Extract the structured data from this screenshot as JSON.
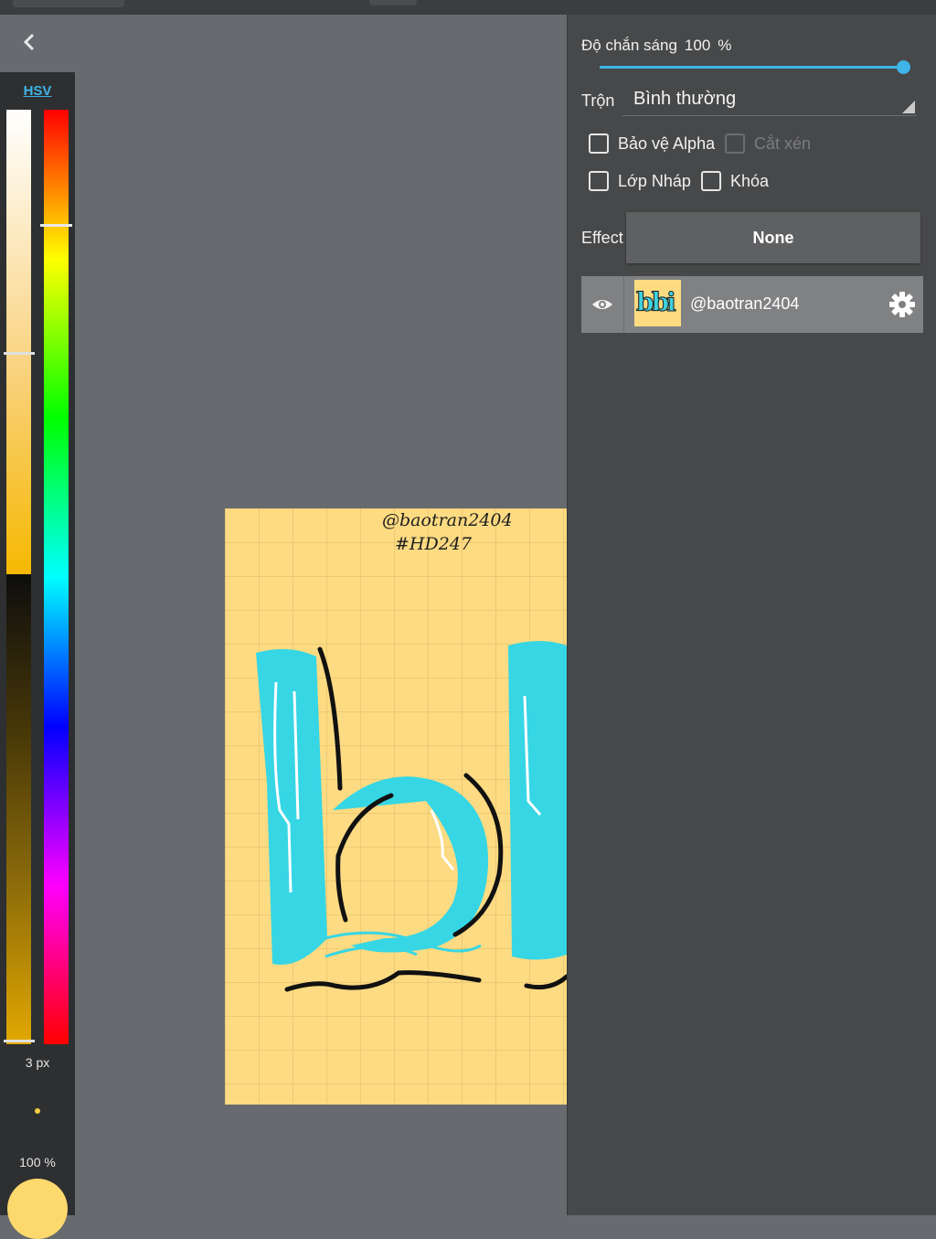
{
  "toolbar": {
    "back_icon": "chevron-left-icon"
  },
  "color_panel": {
    "mode_label": "HSV",
    "brush_size": "3 px",
    "brush_opacity": "100 %",
    "current_color": "#fdd86d",
    "saturation_value_level": 0.26,
    "hue_level": 0.12
  },
  "layer_props": {
    "opacity_label": "Độ chắn sáng",
    "opacity_value": "100",
    "opacity_unit": "%",
    "opacity_level": 1.0,
    "blend_label": "Trộn",
    "blend_value": "Bình thường",
    "checkboxes": {
      "protect_alpha": "Bảo vệ Alpha",
      "clipping": "Cắt xén",
      "draft_layer": "Lớp Nháp",
      "lock": "Khóa"
    },
    "effect_label": "Effect",
    "effect_value": "None"
  },
  "layers": [
    {
      "name": "@baotran2404",
      "thumb_text": "bbi",
      "visible": true
    }
  ],
  "canvas": {
    "credit_line1": "@baotran2404",
    "credit_line2": "#HD247",
    "paper_color": "#fcdb82",
    "accent_color": "#3ed2e0"
  }
}
